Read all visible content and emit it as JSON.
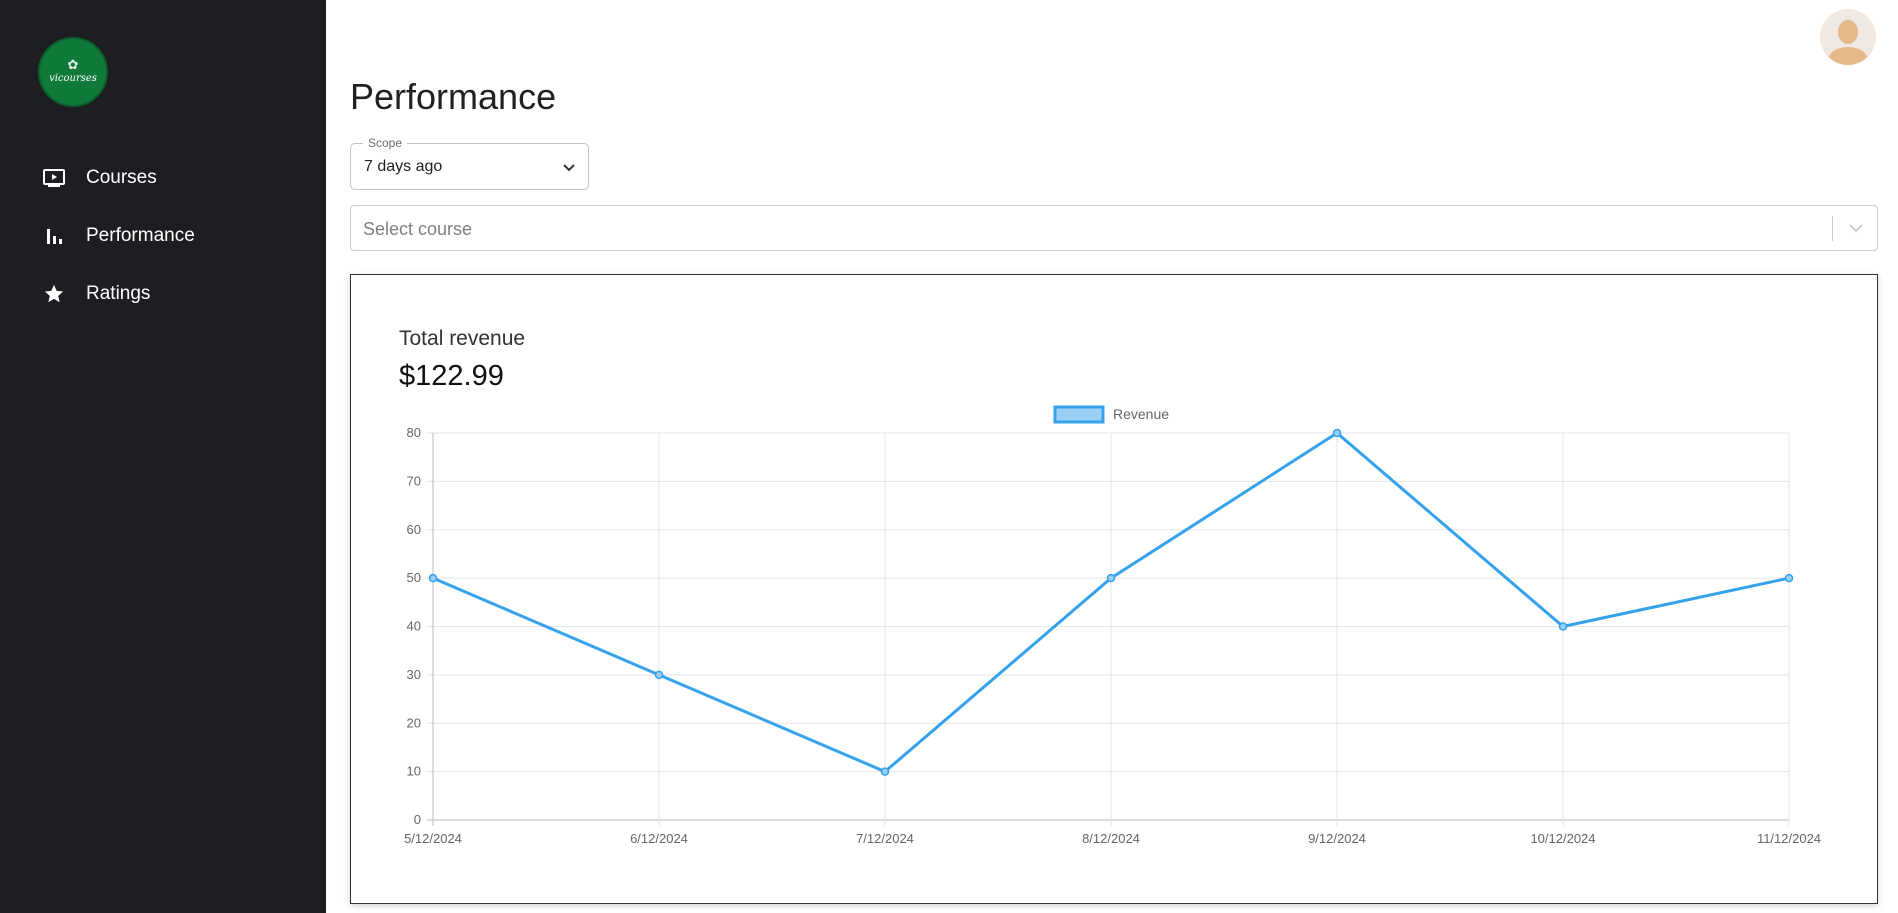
{
  "sidebar": {
    "logo_text": "vicourses",
    "items": [
      {
        "label": "Courses",
        "icon": "video-play-icon"
      },
      {
        "label": "Performance",
        "icon": "bar-chart-icon"
      },
      {
        "label": "Ratings",
        "icon": "star-icon"
      }
    ]
  },
  "header": {
    "title": "Performance",
    "avatar_icon": "user-avatar-icon"
  },
  "filters": {
    "scope_label": "Scope",
    "scope_value": "7 days ago",
    "course_placeholder": "Select course"
  },
  "summary": {
    "label": "Total revenue",
    "value": "$122.99"
  },
  "colors": {
    "sidebar_bg": "#1c1e21",
    "accent": "#36a2eb",
    "logo_bg": "#0f7a3a"
  },
  "chart_data": {
    "type": "line",
    "categories": [
      "5/12/2024",
      "6/12/2024",
      "7/12/2024",
      "8/12/2024",
      "9/12/2024",
      "10/12/2024",
      "11/12/2024"
    ],
    "series": [
      {
        "name": "Revenue",
        "values": [
          50,
          30,
          10,
          50,
          80,
          40,
          50
        ]
      }
    ],
    "yticks": [
      0,
      10,
      20,
      30,
      40,
      50,
      60,
      70,
      80
    ],
    "ylim": [
      0,
      80
    ],
    "grid": true,
    "legend": "top-center"
  }
}
